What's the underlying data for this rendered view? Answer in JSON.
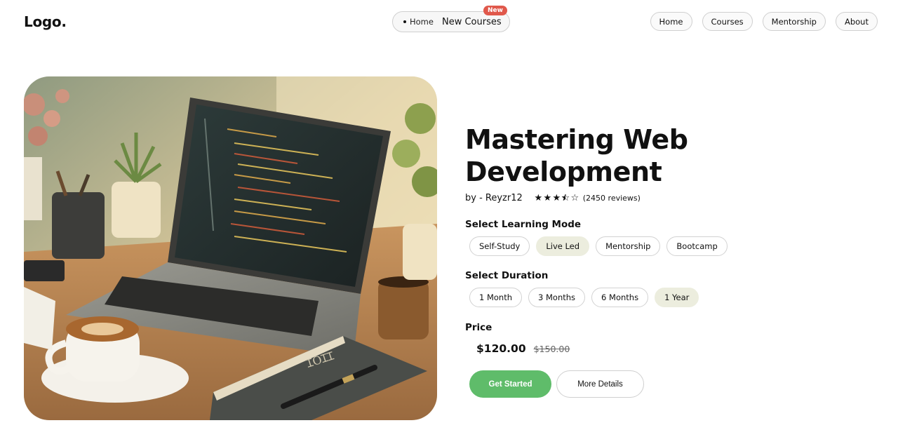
{
  "brand": {
    "logo": "Logo."
  },
  "center_nav": {
    "home": "Home",
    "courses": "New Courses",
    "badge": "New"
  },
  "nav": [
    "Home",
    "Courses",
    "Mentorship",
    "About"
  ],
  "course": {
    "title": "Mastering Web Development",
    "author": "by - Reyzr12",
    "rating": 3.5,
    "rating_max": 5,
    "reviews": "(2450 reviews)",
    "learning_mode": {
      "label": "Select Learning Mode",
      "options": [
        "Self-Study",
        "Live Led",
        "Mentorship",
        "Bootcamp"
      ],
      "selected": "Live Led"
    },
    "duration": {
      "label": "Select Duration",
      "options": [
        "1 Month",
        "3 Months",
        "6 Months",
        "1 Year"
      ],
      "selected": "1 Year"
    },
    "price": {
      "label": "Price",
      "current": "$120.00",
      "original": "$150.00"
    },
    "actions": {
      "primary": "Get Started",
      "secondary": "More Details"
    }
  },
  "colors": {
    "accent_green": "#5fbc6a",
    "selected_chip": "#ecedde",
    "badge_red": "#e0584b"
  },
  "icons": [
    "star-filled-icon",
    "star-half-icon",
    "star-outline-icon",
    "bullet-dot-icon"
  ]
}
